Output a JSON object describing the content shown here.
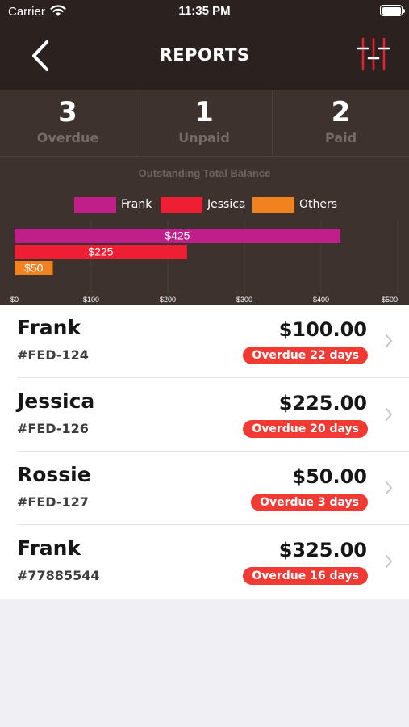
{
  "status_bar": {
    "carrier": "Carrier",
    "time": "11:35 PM"
  },
  "header": {
    "title": "REPORTS",
    "back_icon": "chevron-left-icon",
    "filter_icon": "sliders-icon"
  },
  "stats": [
    {
      "value": "3",
      "label": "Overdue"
    },
    {
      "value": "1",
      "label": "Unpaid"
    },
    {
      "value": "2",
      "label": "Paid"
    }
  ],
  "colors": {
    "frank": "#c01f8a",
    "jessica": "#ee1f34",
    "others": "#f08220",
    "overdue_badge": "#f03a33",
    "header_bg": "#2b2220",
    "panel_bg": "#3d322e"
  },
  "chart_data": {
    "type": "bar",
    "orientation": "horizontal",
    "title": "Outstanding Total Balance",
    "series": [
      {
        "name": "Frank",
        "value": 425,
        "label": "$425",
        "color": "#c01f8a"
      },
      {
        "name": "Jessica",
        "value": 225,
        "label": "$225",
        "color": "#ee1f34"
      },
      {
        "name": "Others",
        "value": 50,
        "label": "$50",
        "color": "#f08220"
      }
    ],
    "xlim": [
      0,
      500
    ],
    "xticks": [
      "$0",
      "$100",
      "$200",
      "$300",
      "$400",
      "$500"
    ],
    "legend_position": "top"
  },
  "invoices": [
    {
      "name": "Frank",
      "code": "#FED-124",
      "amount": "$100.00",
      "status": "Overdue 22 days"
    },
    {
      "name": "Jessica",
      "code": "#FED-126",
      "amount": "$225.00",
      "status": "Overdue 20 days"
    },
    {
      "name": "Rossie",
      "code": "#FED-127",
      "amount": "$50.00",
      "status": "Overdue 3 days"
    },
    {
      "name": "Frank",
      "code": "#77885544",
      "amount": "$325.00",
      "status": "Overdue 16 days"
    }
  ]
}
